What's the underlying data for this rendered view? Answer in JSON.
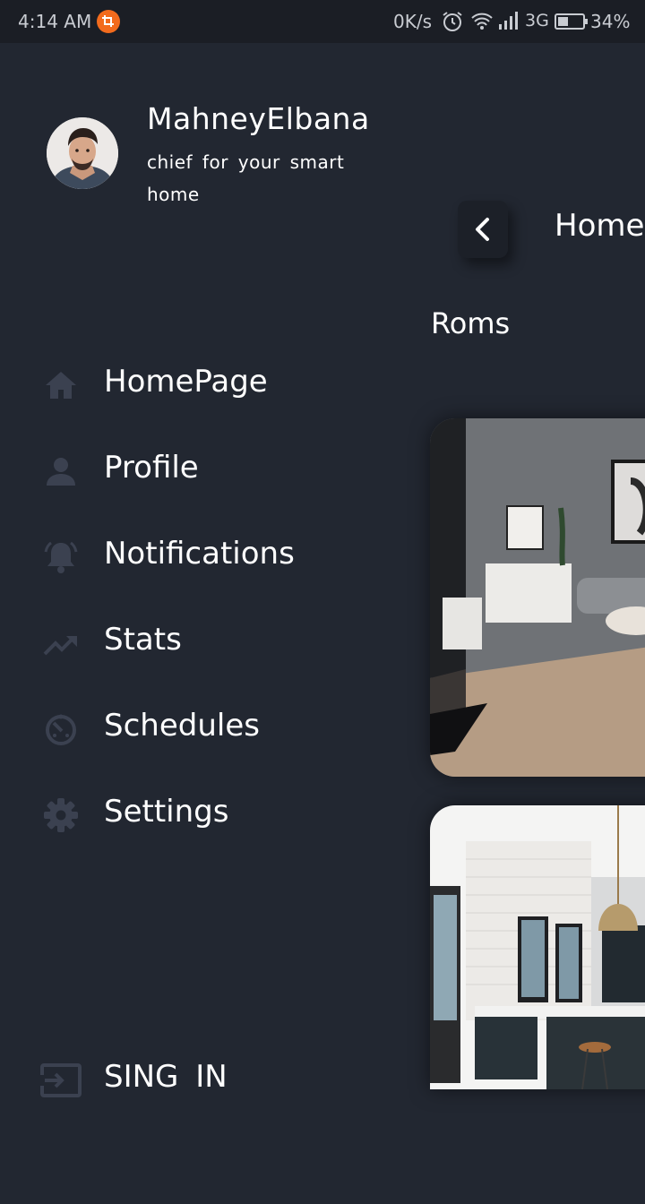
{
  "status_bar": {
    "time": "4:14 AM",
    "net_speed": "0K/s",
    "network_type": "3G",
    "battery": "34%",
    "icons": [
      "notification-badge-icon",
      "alarm-icon",
      "wifi-icon",
      "signal-icon",
      "battery-icon"
    ]
  },
  "drawer": {
    "user": {
      "name": "MahneyElbana",
      "tagline": "chief for your smart home"
    },
    "menu": [
      {
        "label": "HomePage",
        "icon": "home-icon"
      },
      {
        "label": "Profile",
        "icon": "person-icon"
      },
      {
        "label": "Notifications",
        "icon": "bell-icon"
      },
      {
        "label": "Stats",
        "icon": "trending-up-icon"
      },
      {
        "label": "Schedules",
        "icon": "timer-icon"
      },
      {
        "label": "Settings",
        "icon": "gear-icon"
      }
    ],
    "sign_in": {
      "label": "SING IN",
      "icon": "login-icon"
    }
  },
  "page": {
    "title": "Home",
    "section_title": "Roms",
    "rooms": [
      {
        "name": "living-room"
      },
      {
        "name": "kitchen"
      }
    ]
  },
  "colors": {
    "background": "#222731",
    "status_bar": "#1b1e25",
    "icon_muted": "#3b4150",
    "text": "#ffffff",
    "badge": "#f26b1d"
  }
}
